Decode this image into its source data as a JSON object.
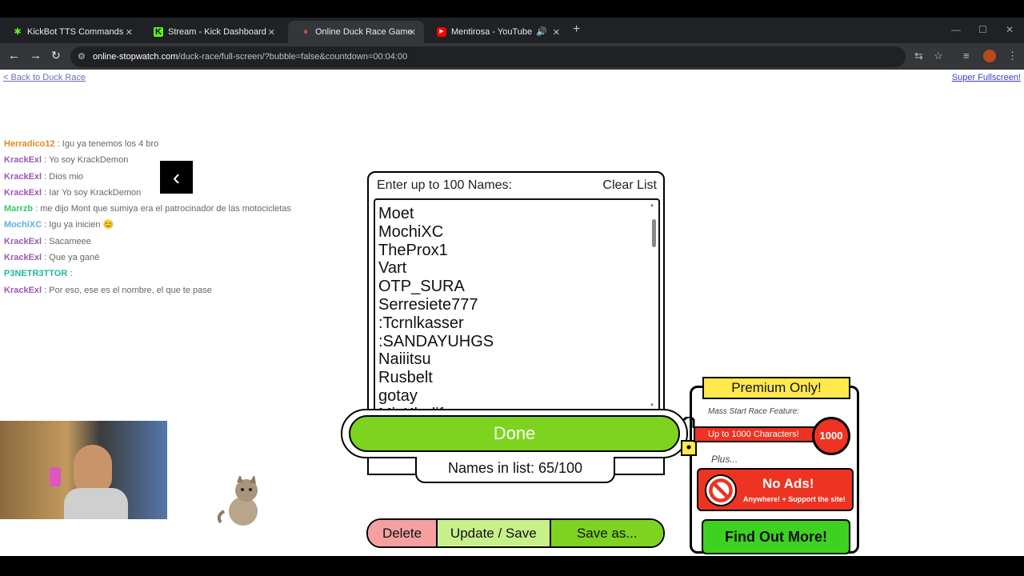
{
  "browser": {
    "tabs": [
      {
        "title": "KickBot TTS Commands",
        "icon": "kickbot-icon"
      },
      {
        "title": "Stream - Kick Dashboard",
        "icon": "kick-icon"
      },
      {
        "title": "Online Duck Race Game",
        "icon": "duck-icon"
      },
      {
        "title": "Mentirosa - YouTube",
        "icon": "youtube-icon"
      }
    ],
    "url_host": "online-stopwatch.com",
    "url_path": "/duck-race/full-screen/?bubble=false&countdown=00:04:00"
  },
  "page": {
    "back_link": "< Back to Duck Race",
    "fullscreen_link": "Super Fullscreen!"
  },
  "chat": [
    {
      "user": "Herradico12",
      "msg": ": Igu ya tenemos los 4 bro",
      "color": "#e08a1e"
    },
    {
      "user": "KrackExl",
      "msg": ": Yo soy KrackDemon",
      "color": "#9b59b6"
    },
    {
      "user": "KrackExl",
      "msg": ": Dios mio",
      "color": "#9b59b6"
    },
    {
      "user": "KrackExl",
      "msg": ": Iar Yo soy KrackDemon",
      "color": "#9b59b6"
    },
    {
      "user": "Marrzb",
      "msg": ": me dijo Mont que sumiya era el patrocinador de las motocicletas",
      "color": "#2ecc71"
    },
    {
      "user": "MochiXC",
      "msg": ": Igu ya inicien 😊",
      "color": "#5dade2"
    },
    {
      "user": "KrackExl",
      "msg": ": Sacameee",
      "color": "#9b59b6"
    },
    {
      "user": "KrackExl",
      "msg": ": Que ya gané",
      "color": "#9b59b6"
    },
    {
      "user": "P3NETR3TTOR",
      "msg": ":",
      "color": "#1abc9c"
    },
    {
      "user": "KrackExl",
      "msg": ": Por eso, ese es el nombre, el que te pase",
      "color": "#9b59b6"
    }
  ],
  "names_panel": {
    "heading": "Enter up to 100 Names:",
    "clear_label": "Clear List",
    "names": [
      "Moet",
      "MochiXC",
      "TheProx1",
      "Vart",
      "OTP_SURA",
      "Serresiete777",
      ":Tcrnlkasser",
      ":SANDAYUHGS",
      "Naiiitsu",
      "Rusbelt",
      "gotay",
      "MiyKhalif"
    ],
    "done_label": "Done",
    "count_text": "Names in list: 65/100",
    "delete_label": "Delete",
    "update_label": "Update / Save",
    "saveas_label": "Save as..."
  },
  "premium": {
    "title": "Premium Only!",
    "mass_start": "Mass Start Race Feature:",
    "chars_text": "Up to 1000 Characters!",
    "chars_num": "1000",
    "plus_text": "Plus...",
    "noads_title": "No Ads!",
    "noads_sub": "Anywhere! + Support the site!",
    "find_label": "Find Out More!"
  },
  "colors": {
    "green": "#7ed321",
    "red": "#e32222",
    "yellow": "#ffe94d"
  }
}
